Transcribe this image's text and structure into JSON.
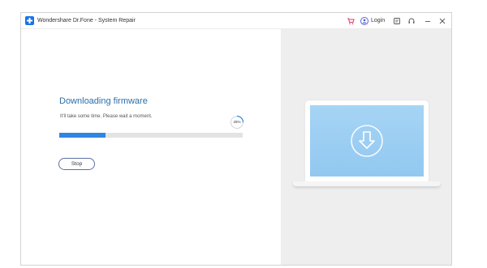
{
  "window": {
    "title": "Wondershare Dr.Fone - System Repair"
  },
  "toolbar": {
    "login_label": "Login"
  },
  "main": {
    "heading": "Downloading firmware",
    "subtext": "It'll take some time. Please wait a moment.",
    "progress_percent": 25,
    "progress_label": "25%",
    "stop_label": "Stop"
  },
  "colors": {
    "accent": "#2f86e0",
    "heading": "#2a6fa8",
    "screen": "#a6d4f5"
  },
  "icons": {
    "app": "dr-fone-logo-icon",
    "cart": "cart-icon",
    "user": "user-icon",
    "feedback": "feedback-icon",
    "support": "headset-icon",
    "minimize": "minimize-icon",
    "close": "close-icon",
    "download": "download-arrow-icon"
  }
}
